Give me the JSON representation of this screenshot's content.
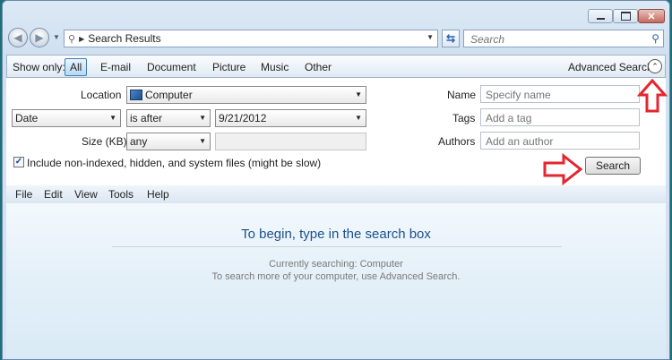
{
  "window": {
    "close_glyph": "✕"
  },
  "address_bar": {
    "path_text": "Search Results",
    "search_placeholder": "Search"
  },
  "show_only": {
    "label": "Show only:",
    "filters": [
      "All",
      "E-mail",
      "Document",
      "Picture",
      "Music",
      "Other"
    ],
    "active_filter": "All",
    "advanced_label": "Advanced Search"
  },
  "advanced": {
    "location_label": "Location",
    "location_value": "Computer",
    "date_field": "Date",
    "date_condition": "is after",
    "date_value": "9/21/2012",
    "size_label": "Size (KB)",
    "size_value": "any",
    "name_label": "Name",
    "name_placeholder": "Specify name",
    "tags_label": "Tags",
    "tags_placeholder": "Add a tag",
    "authors_label": "Authors",
    "authors_placeholder": "Add an author",
    "include_label": "Include non-indexed, hidden, and system files (might be slow)",
    "include_checked": true,
    "search_button": "Search"
  },
  "menu": [
    "File",
    "Edit",
    "View",
    "Tools",
    "Help"
  ],
  "content": {
    "heading": "To begin, type in the search box",
    "currently": "Currently searching: Computer",
    "hint": "To search more of your computer, use Advanced Search."
  },
  "annotations": {
    "arrow_color": "#e3262f"
  }
}
